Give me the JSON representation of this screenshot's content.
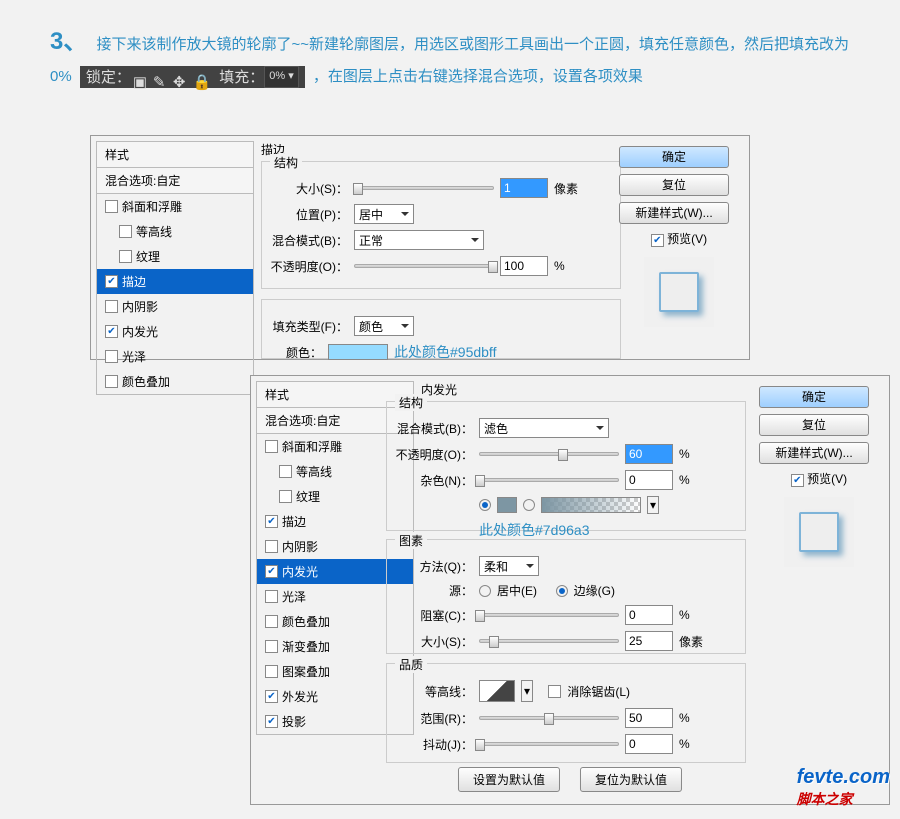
{
  "step": {
    "number": "3、",
    "text_before": "接下来该制作放大镜的轮廓了~~新建轮廓图层，用选区或图形工具画出一个正圆，填充任意颜色，然后把填充改为 0%",
    "text_after": "，在图层上点击右键选择混合选项，设置各项效果",
    "lock_label": "锁定：",
    "fill_label": "填充：",
    "fill_value": "0%"
  },
  "panel1": {
    "styles_header": "样式",
    "blend_opts": "混合选项:自定",
    "items": [
      {
        "label": "斜面和浮雕",
        "on": false,
        "sub": false
      },
      {
        "label": "等高线",
        "on": false,
        "sub": true
      },
      {
        "label": "纹理",
        "on": false,
        "sub": true
      },
      {
        "label": "描边",
        "on": true,
        "sub": false,
        "sel": true
      },
      {
        "label": "内阴影",
        "on": false,
        "sub": false
      },
      {
        "label": "内发光",
        "on": true,
        "sub": false
      },
      {
        "label": "光泽",
        "on": false,
        "sub": false
      },
      {
        "label": "颜色叠加",
        "on": false,
        "sub": false
      }
    ],
    "section_title": "描边",
    "group1": "结构",
    "size_label": "大小(S)：",
    "size_value": "1",
    "size_unit": "像素",
    "position_label": "位置(P)：",
    "position_value": "居中",
    "blend_label": "混合模式(B)：",
    "blend_value": "正常",
    "opacity_label": "不透明度(O)：",
    "opacity_value": "100",
    "opacity_unit": "%",
    "filltype_label": "填充类型(F)：",
    "filltype_value": "颜色",
    "color_label": "颜色：",
    "color_annot": "此处颜色#95dbff",
    "color_hex": "#95dbff",
    "ok": "确定",
    "reset": "复位",
    "newstyle": "新建样式(W)...",
    "preview": "预览(V)"
  },
  "panel2": {
    "styles_header": "样式",
    "blend_opts": "混合选项:自定",
    "items": [
      {
        "label": "斜面和浮雕",
        "on": false,
        "sub": false
      },
      {
        "label": "等高线",
        "on": false,
        "sub": true
      },
      {
        "label": "纹理",
        "on": false,
        "sub": true
      },
      {
        "label": "描边",
        "on": true,
        "sub": false
      },
      {
        "label": "内阴影",
        "on": false,
        "sub": false
      },
      {
        "label": "内发光",
        "on": true,
        "sub": false,
        "sel": true
      },
      {
        "label": "光泽",
        "on": false,
        "sub": false
      },
      {
        "label": "颜色叠加",
        "on": false,
        "sub": false
      },
      {
        "label": "渐变叠加",
        "on": false,
        "sub": false
      },
      {
        "label": "图案叠加",
        "on": false,
        "sub": false
      },
      {
        "label": "外发光",
        "on": true,
        "sub": false
      },
      {
        "label": "投影",
        "on": true,
        "sub": false
      }
    ],
    "section_title": "内发光",
    "group1": "结构",
    "blend_label": "混合模式(B)：",
    "blend_value": "滤色",
    "opacity_label": "不透明度(O)：",
    "opacity_value": "60",
    "opacity_unit": "%",
    "noise_label": "杂色(N)：",
    "noise_value": "0",
    "noise_unit": "%",
    "color_annot": "此处颜色#7d96a3",
    "color_hex": "#7d96a3",
    "group2": "图素",
    "method_label": "方法(Q)：",
    "method_value": "柔和",
    "source_label": "源：",
    "source_center": "居中(E)",
    "source_edge": "边缘(G)",
    "choke_label": "阻塞(C)：",
    "choke_value": "0",
    "choke_unit": "%",
    "size_label": "大小(S)：",
    "size_value": "25",
    "size_unit": "像素",
    "group3": "品质",
    "contour_label": "等高线：",
    "antialias": "消除锯齿(L)",
    "range_label": "范围(R)：",
    "range_value": "50",
    "range_unit": "%",
    "jitter_label": "抖动(J)：",
    "jitter_value": "0",
    "jitter_unit": "%",
    "set_default": "设置为默认值",
    "reset_default": "复位为默认值",
    "ok": "确定",
    "reset": "复位",
    "newstyle": "新建样式(W)...",
    "preview": "预览(V)"
  },
  "watermark": {
    "line1": "fevte.com",
    "line2": "脚本之家"
  }
}
